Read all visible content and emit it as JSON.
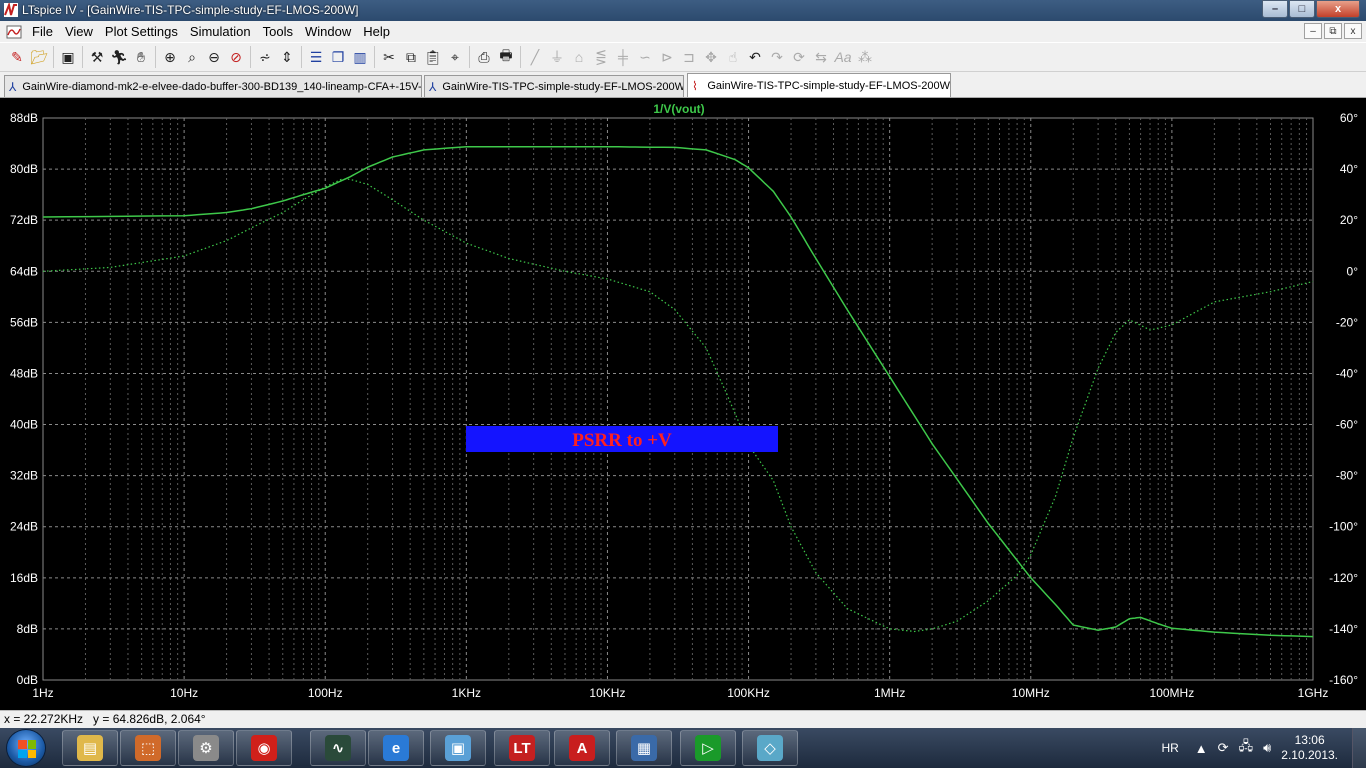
{
  "window": {
    "title": "LTspice IV - [GainWire-TIS-TPC-simple-study-EF-LMOS-200W]",
    "buttons": {
      "minimize": "–",
      "maximize": "□",
      "close": "x"
    }
  },
  "menu": {
    "items": [
      "File",
      "View",
      "Plot Settings",
      "Simulation",
      "Tools",
      "Window",
      "Help"
    ],
    "mdi": {
      "minimize": "–",
      "restore": "⧉",
      "close": "x"
    }
  },
  "toolbar": {
    "icons": [
      "new-schematic-icon",
      "open-icon",
      "save-icon",
      "control-panel-icon",
      "run-icon",
      "pan-icon",
      "zoom-in-icon",
      "zoom-area-icon",
      "zoom-out-icon",
      "zoom-cancel-icon",
      "autorange-icon",
      "vertical-autorange-icon",
      "tile-horizontal-icon",
      "cascade-icon",
      "tile-vertical-icon",
      "cut-icon",
      "copy-icon",
      "paste-icon",
      "find-icon",
      "print-setup-icon",
      "print-icon",
      "wire-icon",
      "ground-icon",
      "label-icon",
      "resistor-icon",
      "capacitor-icon",
      "inductor-icon",
      "diode-icon",
      "component-icon",
      "move-icon",
      "drag-icon",
      "undo-icon",
      "redo-icon",
      "rotate-icon",
      "mirror-icon",
      "text-icon",
      "spice-directive-icon"
    ]
  },
  "tabs": [
    {
      "label": "GainWire-diamond-mk2-e-elvee-dado-buffer-300-BD139_140-lineamp-CFA+-15V-c",
      "icon": "schematic-icon",
      "active": false
    },
    {
      "label": "GainWire-TIS-TPC-simple-study-EF-LMOS-200W",
      "icon": "schematic-icon",
      "active": false
    },
    {
      "label": "GainWire-TIS-TPC-simple-study-EF-LMOS-200W",
      "icon": "waveform-icon",
      "active": true
    }
  ],
  "status": {
    "cursor_readout": "x = 22.272KHz   y = 64.826dB, 2.064°"
  },
  "taskbar": {
    "apps": [
      {
        "name": "explorer",
        "glyph": "▤",
        "color": "#e0b84a"
      },
      {
        "name": "installer",
        "glyph": "⬚",
        "color": "#d06a2a"
      },
      {
        "name": "tool",
        "glyph": "⚙",
        "color": "#8a8a8a"
      },
      {
        "name": "security",
        "glyph": "◉",
        "color": "#d0201a"
      },
      {
        "name": "oscilloscope",
        "glyph": "∿",
        "color": "#2a4a3a"
      },
      {
        "name": "internet-explorer",
        "glyph": "e",
        "color": "#2a7ad6"
      },
      {
        "name": "file-manager",
        "glyph": "▣",
        "color": "#5aa0d6"
      },
      {
        "name": "ltspice",
        "glyph": "LT",
        "color": "#c42020"
      },
      {
        "name": "pdf-reader",
        "glyph": "A",
        "color": "#c81e1e"
      },
      {
        "name": "document-viewer",
        "glyph": "▦",
        "color": "#3a6aa8"
      },
      {
        "name": "eagle",
        "glyph": "▷",
        "color": "#1a9a2a"
      },
      {
        "name": "notes",
        "glyph": "◇",
        "color": "#5aa8c8"
      }
    ],
    "language": "HR",
    "time": "13:06",
    "date": "2.10.2013."
  },
  "colors": {
    "trace": "#3ec84a",
    "grid": "#8a8a8a",
    "axis_text": "#ffffff",
    "label_box": "#1414ff",
    "label_text": "#ff2020",
    "plot_background": "#000000"
  },
  "chart_data": {
    "type": "line",
    "title": "1/V(vout)",
    "annotation": "PSRR to +V",
    "x_scale": "log",
    "xlim": [
      1,
      1000000000
    ],
    "x_ticks": [
      "1Hz",
      "10Hz",
      "100Hz",
      "1KHz",
      "10KHz",
      "100KHz",
      "1MHz",
      "10MHz",
      "100MHz",
      "1GHz"
    ],
    "left_axis": {
      "unit": "dB",
      "ylim": [
        0,
        88
      ],
      "ticks": [
        "88dB",
        "80dB",
        "72dB",
        "64dB",
        "56dB",
        "48dB",
        "40dB",
        "32dB",
        "24dB",
        "16dB",
        "8dB",
        "0dB"
      ]
    },
    "right_axis": {
      "unit": "°",
      "ylim": [
        -160,
        60
      ],
      "ticks": [
        "60°",
        "40°",
        "20°",
        "0°",
        "-20°",
        "-40°",
        "-60°",
        "-80°",
        "-100°",
        "-120°",
        "-140°",
        "-160°"
      ]
    },
    "grid": true,
    "series": [
      {
        "style": "solid",
        "axis": "left",
        "x": [
          1,
          10,
          20,
          30,
          50,
          70,
          100,
          150,
          200,
          300,
          500,
          1000,
          10000,
          30000,
          50000,
          80000,
          100000,
          150000,
          200000,
          300000,
          500000,
          1000000,
          2000000,
          5000000,
          10000000,
          15000000,
          20000000,
          30000000,
          40000000,
          50000000,
          60000000,
          80000000,
          100000000,
          200000000,
          500000000,
          1000000000
        ],
        "y": [
          72.5,
          72.7,
          73.2,
          73.8,
          75,
          76,
          77,
          78.8,
          80.3,
          81.9,
          83,
          83.5,
          83.5,
          83.4,
          83,
          81.5,
          80.2,
          76.5,
          72.5,
          66,
          58,
          47.5,
          37,
          24.5,
          16,
          11.8,
          8.6,
          7.8,
          8.3,
          9.6,
          9.8,
          8.8,
          8.1,
          7.5,
          7.0,
          6.8
        ]
      },
      {
        "style": "dotted",
        "axis": "right",
        "x": [
          1,
          3,
          10,
          20,
          30,
          50,
          70,
          100,
          130,
          150,
          200,
          300,
          500,
          1000,
          2000,
          5000,
          10000,
          20000,
          30000,
          50000,
          70000,
          100000,
          150000,
          200000,
          300000,
          500000,
          1000000,
          1500000,
          2000000,
          3000000,
          5000000,
          8000000,
          10000000,
          15000000,
          20000000,
          30000000,
          40000000,
          50000000,
          70000000,
          100000000,
          200000000,
          500000000,
          1000000000
        ],
        "y": [
          0,
          1.5,
          6,
          12,
          17,
          23,
          28,
          33,
          36,
          36,
          34,
          28,
          20,
          11,
          5,
          0,
          -3,
          -8,
          -15,
          -30,
          -48,
          -68,
          -82,
          -100,
          -118,
          -132,
          -140,
          -141,
          -140,
          -137,
          -129,
          -119,
          -111,
          -88,
          -65,
          -38,
          -24,
          -19,
          -23,
          -21,
          -12,
          -8,
          -4
        ]
      }
    ]
  }
}
